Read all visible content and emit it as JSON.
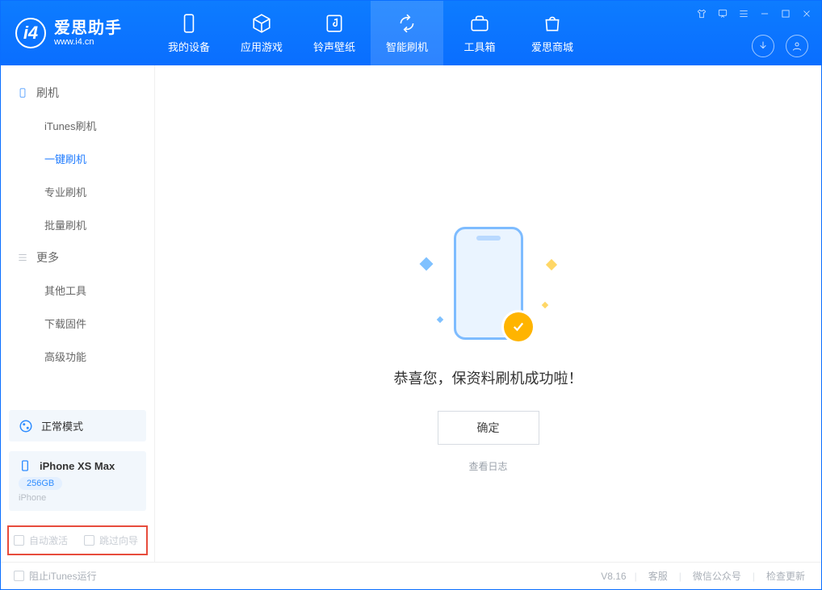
{
  "app": {
    "name": "爱思助手",
    "site": "www.i4.cn"
  },
  "nav": {
    "items": [
      {
        "label": "我的设备"
      },
      {
        "label": "应用游戏"
      },
      {
        "label": "铃声壁纸"
      },
      {
        "label": "智能刷机"
      },
      {
        "label": "工具箱"
      },
      {
        "label": "爱思商城"
      }
    ],
    "activeIndex": 3
  },
  "sidebar": {
    "group1_title": "刷机",
    "group1_items": [
      "iTunes刷机",
      "一键刷机",
      "专业刷机",
      "批量刷机"
    ],
    "group1_active": 1,
    "group2_title": "更多",
    "group2_items": [
      "其他工具",
      "下载固件",
      "高级功能"
    ],
    "mode_label": "正常模式",
    "device": {
      "name": "iPhone XS Max",
      "capacity": "256GB",
      "type": "iPhone"
    },
    "opts": {
      "auto_activate": "自动激活",
      "skip_guide": "跳过向导"
    }
  },
  "main": {
    "success_text": "恭喜您，保资料刷机成功啦！",
    "ok_button": "确定",
    "view_log": "查看日志"
  },
  "footer": {
    "block_itunes": "阻止iTunes运行",
    "version": "V8.16",
    "links": [
      "客服",
      "微信公众号",
      "检查更新"
    ]
  }
}
